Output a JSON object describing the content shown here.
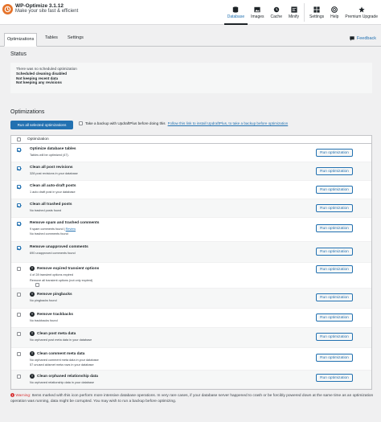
{
  "app": {
    "title": "WP-Optimize 3.1.12",
    "subtitle": "Make your site fast & efficient",
    "nav": [
      {
        "label": "Database",
        "icon": "database-icon",
        "active": true
      },
      {
        "label": "Images",
        "icon": "image-icon"
      },
      {
        "label": "Cache",
        "icon": "cache-icon"
      },
      {
        "label": "Minify",
        "icon": "minify-icon"
      },
      {
        "label": "Settings",
        "icon": "settings-icon"
      },
      {
        "label": "Help",
        "icon": "help-icon"
      },
      {
        "label": "Premium Upgrade",
        "icon": "premium-icon"
      }
    ]
  },
  "tabs": [
    {
      "label": "Optimizations",
      "active": true
    },
    {
      "label": "Tables"
    },
    {
      "label": "Settings"
    }
  ],
  "feedback_label": "Feedback",
  "status": {
    "heading": "Status",
    "lines": [
      {
        "text": "There was no scheduled optimization",
        "bold": false
      },
      {
        "text": "Scheduled cleaning disabled",
        "bold": true
      },
      {
        "text": "Not keeping recent data",
        "bold": true
      },
      {
        "text": "Not keeping any revisions",
        "bold": true
      }
    ]
  },
  "optimizations": {
    "heading": "Optimizations",
    "run_all_label": "Run all selected optimizations",
    "backup_text": "Take a backup with UpdraftPlus before doing this",
    "backup_link": "Follow this link to install UpdraftPlus, to take a backup before optimization",
    "column_header": "Optimization",
    "run_label": "Run optimization",
    "rows": [
      {
        "title": "Optimize database tables",
        "details": [
          "Tables will be optimized (47)."
        ],
        "checked": true,
        "warn": false
      },
      {
        "title": "Clean all post revisions",
        "details": [
          "328 post revisions in your database"
        ],
        "checked": true,
        "warn": false
      },
      {
        "title": "Clean all auto-draft posts",
        "details": [
          "1 auto draft post in your database"
        ],
        "checked": true,
        "warn": false
      },
      {
        "title": "Clean all trashed posts",
        "details": [
          "No trashed posts found"
        ],
        "checked": true,
        "warn": false
      },
      {
        "title": "Remove spam and trashed comments",
        "details": [
          "9 spam comments found | ",
          "No trashed comments found"
        ],
        "review_link": "Review",
        "checked": true,
        "warn": false
      },
      {
        "title": "Remove unapproved comments",
        "details": [
          "690 unapproved comments found"
        ],
        "checked": true,
        "warn": false
      },
      {
        "title": "Remove expired transient options",
        "details": [
          "4 of 28 transient options expired"
        ],
        "sub_checkbox": "Remove all transient options (not only expired)",
        "checked": false,
        "warn": true
      },
      {
        "title": "Remove pingbacks",
        "details": [
          "No pingbacks found"
        ],
        "checked": false,
        "warn": true
      },
      {
        "title": "Remove trackbacks",
        "details": [
          "No trackbacks found"
        ],
        "checked": false,
        "warn": true
      },
      {
        "title": "Clean post meta data",
        "details": [
          "No orphaned post meta data in your database"
        ],
        "checked": false,
        "warn": true
      },
      {
        "title": "Clean comment meta data",
        "details": [
          "No orphaned comment meta data in your database",
          "57 unused akismet meta rows in your database"
        ],
        "checked": false,
        "warn": true
      },
      {
        "title": "Clean orphaned relationship data",
        "details": [
          "No orphaned relationship data in your database"
        ],
        "checked": false,
        "warn": true
      }
    ]
  },
  "footnote": {
    "warning_label": "Warning:",
    "text": "Items marked with this icon perform more intensive database operations. In very rare cases, if your database server happened to crash or be forcibly powered down at the same time as an optimization operation was running, data might be corrupted. You may wish to run a backup before optimizing."
  },
  "colors": {
    "accent": "#2271b1",
    "logo": "#e5732a",
    "warning": "#d63638"
  }
}
